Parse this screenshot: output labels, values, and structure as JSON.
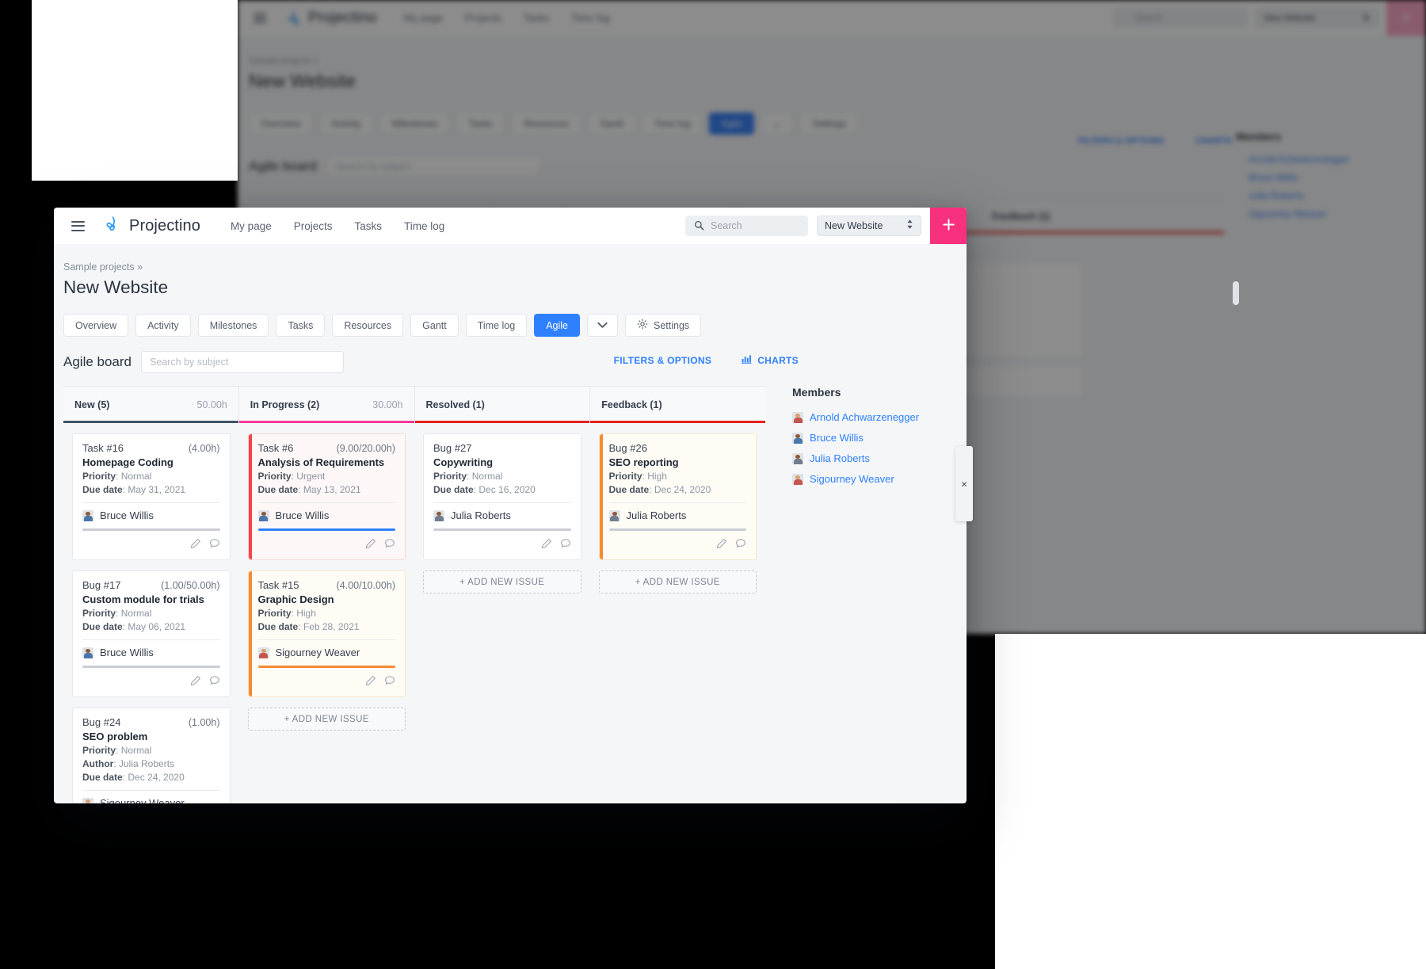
{
  "app": {
    "name": "Projectino",
    "menu_icon": "hamburger-icon",
    "logo_icon": "projectino-logo-icon",
    "nav": [
      {
        "label": "My page"
      },
      {
        "label": "Projects"
      },
      {
        "label": "Tasks"
      },
      {
        "label": "Time log"
      }
    ],
    "search": {
      "placeholder": "Search",
      "value": "",
      "icon": "search-icon"
    },
    "project_select": {
      "value": "New Website",
      "icon": "chevron-updown-icon"
    },
    "add_button": {
      "label": "+",
      "icon": "plus-icon",
      "color": "#f8317f"
    }
  },
  "breadcrumb": "Sample projects »",
  "page_title": "New Website",
  "tabs": [
    {
      "label": "Overview",
      "active": false
    },
    {
      "label": "Activity",
      "active": false
    },
    {
      "label": "Milestones",
      "active": false
    },
    {
      "label": "Tasks",
      "active": false
    },
    {
      "label": "Resources",
      "active": false
    },
    {
      "label": "Gantt",
      "active": false
    },
    {
      "label": "Time log",
      "active": false
    },
    {
      "label": "Agile",
      "active": true
    }
  ],
  "tab_more_icon": "chevron-down-icon",
  "settings_tab": {
    "label": "Settings",
    "icon": "gear-icon"
  },
  "board": {
    "title": "Agile board",
    "search": {
      "placeholder": "Search by subject",
      "value": ""
    },
    "links": [
      {
        "label": "FILTERS & OPTIONS",
        "icon": null
      },
      {
        "label": "CHARTS",
        "icon": "bar-chart-icon"
      }
    ],
    "accent_link_color": "#2f80ff",
    "columns": [
      {
        "name": "New (5)",
        "hours": "50.00h",
        "underline_color": "#3f5463",
        "add_new_label": "",
        "has_add_new": false,
        "cards": [
          {
            "id": "Task #16",
            "estimate": "(4.00h)",
            "subject": "Homepage Coding",
            "fields": [
              {
                "label": "Priority",
                "value": "Normal"
              },
              {
                "label": "Due date",
                "value": "May 31, 2021"
              }
            ],
            "assignee": "Bruce Willis",
            "avatar": "male-avatar",
            "stripe_color": null,
            "card_bg": "#ffffff",
            "progress_color": "#c9ced6",
            "progress_pct": 100,
            "actions": [
              "edit-icon",
              "comment-icon"
            ]
          },
          {
            "id": "Bug #17",
            "estimate": "(1.00/50.00h)",
            "subject": "Custom module for trials",
            "fields": [
              {
                "label": "Priority",
                "value": "Normal"
              },
              {
                "label": "Due date",
                "value": "May 06, 2021"
              }
            ],
            "assignee": "Bruce Willis",
            "avatar": "male-avatar",
            "stripe_color": null,
            "card_bg": "#ffffff",
            "progress_color": "#c9ced6",
            "progress_pct": 100,
            "actions": [
              "edit-icon",
              "comment-icon"
            ]
          },
          {
            "id": "Bug #24",
            "estimate": "(1.00h)",
            "subject": "SEO problem",
            "fields": [
              {
                "label": "Priority",
                "value": "Normal"
              },
              {
                "label": "Author",
                "value": "Julia Roberts"
              },
              {
                "label": "Due date",
                "value": "Dec 24, 2020"
              }
            ],
            "assignee": "Sigourney Weaver",
            "avatar": "female-avatar",
            "stripe_color": null,
            "card_bg": "#ffffff",
            "progress_color": "#c9ced6",
            "progress_pct": 100,
            "actions": [
              "edit-icon",
              "comment-icon"
            ]
          }
        ]
      },
      {
        "name": "In Progress (2)",
        "hours": "30.00h",
        "underline_color": "#f5379a",
        "add_new_label": "+ ADD NEW ISSUE",
        "has_add_new": true,
        "cards": [
          {
            "id": "Task #6",
            "estimate": "(9.00/20.00h)",
            "subject": "Analysis of Requirements",
            "fields": [
              {
                "label": "Priority",
                "value": "Urgent"
              },
              {
                "label": "Due date",
                "value": "May 13, 2021"
              }
            ],
            "assignee": "Bruce Willis",
            "avatar": "male-avatar",
            "stripe_color": "#f4434a",
            "card_bg": "#fef7f7",
            "progress_color": "#2f80ff",
            "progress_pct": 100,
            "actions": [
              "edit-icon",
              "comment-icon"
            ]
          },
          {
            "id": "Task #15",
            "estimate": "(4.00/10.00h)",
            "subject": "Graphic Design",
            "fields": [
              {
                "label": "Priority",
                "value": "High"
              },
              {
                "label": "Due date",
                "value": "Feb 28, 2021"
              }
            ],
            "assignee": "Sigourney Weaver",
            "avatar": "female-avatar",
            "stripe_color": "#f58b33",
            "card_bg": "#fffcf7",
            "progress_color": "#f58b33",
            "progress_pct": 100,
            "actions": [
              "edit-icon",
              "comment-icon"
            ]
          }
        ]
      },
      {
        "name": "Resolved (1)",
        "hours": "",
        "underline_color": "#e3231e",
        "add_new_label": "+ ADD NEW ISSUE",
        "has_add_new": true,
        "cards": [
          {
            "id": "Bug #27",
            "estimate": "",
            "subject": "Copywriting",
            "fields": [
              {
                "label": "Priority",
                "value": "Normal"
              },
              {
                "label": "Due date",
                "value": "Dec 16, 2020"
              }
            ],
            "assignee": "Julia Roberts",
            "avatar": "generic-avatar",
            "stripe_color": null,
            "card_bg": "#ffffff",
            "progress_color": "#c9ced6",
            "progress_pct": 100,
            "actions": [
              "edit-icon",
              "comment-icon"
            ]
          }
        ]
      },
      {
        "name": "Feedback (1)",
        "hours": "",
        "underline_color": "#e3231e",
        "add_new_label": "+ ADD NEW ISSUE",
        "has_add_new": true,
        "cards": [
          {
            "id": "Bug #26",
            "estimate": "",
            "subject": "SEO reporting",
            "fields": [
              {
                "label": "Priority",
                "value": "High"
              },
              {
                "label": "Due date",
                "value": "Dec 24, 2020"
              }
            ],
            "assignee": "Julia Roberts",
            "avatar": "generic-avatar",
            "stripe_color": "#f58b33",
            "card_bg": "#fffcf7",
            "progress_color": "#c9ced6",
            "progress_pct": 100,
            "actions": [
              "edit-icon",
              "comment-icon"
            ]
          }
        ]
      }
    ]
  },
  "members": {
    "title": "Members",
    "list": [
      {
        "name": "Arnold Achwarzenegger",
        "avatar": "female-avatar"
      },
      {
        "name": "Bruce Willis",
        "avatar": "male-avatar"
      },
      {
        "name": "Julia Roberts",
        "avatar": "generic-avatar"
      },
      {
        "name": "Sigourney Weaver",
        "avatar": "female-avatar"
      }
    ]
  },
  "overlay": {
    "close_label": "×"
  }
}
